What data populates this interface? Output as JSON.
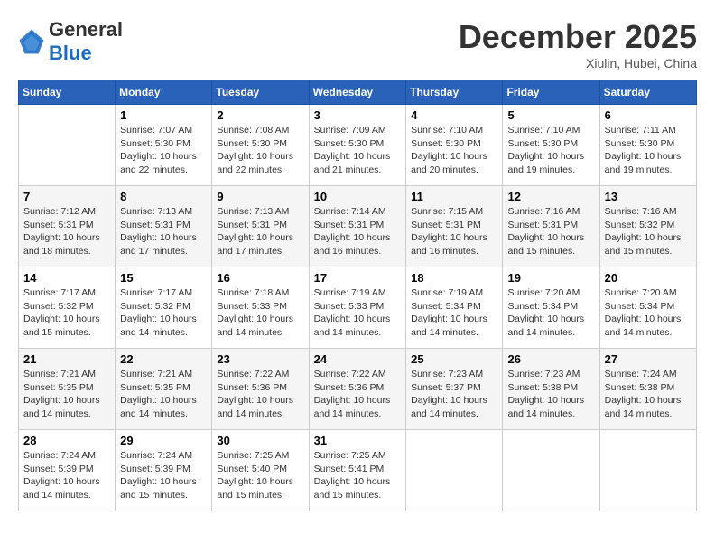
{
  "header": {
    "logo_line1": "General",
    "logo_line2": "Blue",
    "month_title": "December 2025",
    "location": "Xiulin, Hubei, China"
  },
  "calendar": {
    "days_of_week": [
      "Sunday",
      "Monday",
      "Tuesday",
      "Wednesday",
      "Thursday",
      "Friday",
      "Saturday"
    ],
    "weeks": [
      [
        {
          "day": "",
          "info": ""
        },
        {
          "day": "1",
          "info": "Sunrise: 7:07 AM\nSunset: 5:30 PM\nDaylight: 10 hours\nand 22 minutes."
        },
        {
          "day": "2",
          "info": "Sunrise: 7:08 AM\nSunset: 5:30 PM\nDaylight: 10 hours\nand 22 minutes."
        },
        {
          "day": "3",
          "info": "Sunrise: 7:09 AM\nSunset: 5:30 PM\nDaylight: 10 hours\nand 21 minutes."
        },
        {
          "day": "4",
          "info": "Sunrise: 7:10 AM\nSunset: 5:30 PM\nDaylight: 10 hours\nand 20 minutes."
        },
        {
          "day": "5",
          "info": "Sunrise: 7:10 AM\nSunset: 5:30 PM\nDaylight: 10 hours\nand 19 minutes."
        },
        {
          "day": "6",
          "info": "Sunrise: 7:11 AM\nSunset: 5:30 PM\nDaylight: 10 hours\nand 19 minutes."
        }
      ],
      [
        {
          "day": "7",
          "info": "Sunrise: 7:12 AM\nSunset: 5:31 PM\nDaylight: 10 hours\nand 18 minutes."
        },
        {
          "day": "8",
          "info": "Sunrise: 7:13 AM\nSunset: 5:31 PM\nDaylight: 10 hours\nand 17 minutes."
        },
        {
          "day": "9",
          "info": "Sunrise: 7:13 AM\nSunset: 5:31 PM\nDaylight: 10 hours\nand 17 minutes."
        },
        {
          "day": "10",
          "info": "Sunrise: 7:14 AM\nSunset: 5:31 PM\nDaylight: 10 hours\nand 16 minutes."
        },
        {
          "day": "11",
          "info": "Sunrise: 7:15 AM\nSunset: 5:31 PM\nDaylight: 10 hours\nand 16 minutes."
        },
        {
          "day": "12",
          "info": "Sunrise: 7:16 AM\nSunset: 5:31 PM\nDaylight: 10 hours\nand 15 minutes."
        },
        {
          "day": "13",
          "info": "Sunrise: 7:16 AM\nSunset: 5:32 PM\nDaylight: 10 hours\nand 15 minutes."
        }
      ],
      [
        {
          "day": "14",
          "info": "Sunrise: 7:17 AM\nSunset: 5:32 PM\nDaylight: 10 hours\nand 15 minutes."
        },
        {
          "day": "15",
          "info": "Sunrise: 7:17 AM\nSunset: 5:32 PM\nDaylight: 10 hours\nand 14 minutes."
        },
        {
          "day": "16",
          "info": "Sunrise: 7:18 AM\nSunset: 5:33 PM\nDaylight: 10 hours\nand 14 minutes."
        },
        {
          "day": "17",
          "info": "Sunrise: 7:19 AM\nSunset: 5:33 PM\nDaylight: 10 hours\nand 14 minutes."
        },
        {
          "day": "18",
          "info": "Sunrise: 7:19 AM\nSunset: 5:34 PM\nDaylight: 10 hours\nand 14 minutes."
        },
        {
          "day": "19",
          "info": "Sunrise: 7:20 AM\nSunset: 5:34 PM\nDaylight: 10 hours\nand 14 minutes."
        },
        {
          "day": "20",
          "info": "Sunrise: 7:20 AM\nSunset: 5:34 PM\nDaylight: 10 hours\nand 14 minutes."
        }
      ],
      [
        {
          "day": "21",
          "info": "Sunrise: 7:21 AM\nSunset: 5:35 PM\nDaylight: 10 hours\nand 14 minutes."
        },
        {
          "day": "22",
          "info": "Sunrise: 7:21 AM\nSunset: 5:35 PM\nDaylight: 10 hours\nand 14 minutes."
        },
        {
          "day": "23",
          "info": "Sunrise: 7:22 AM\nSunset: 5:36 PM\nDaylight: 10 hours\nand 14 minutes."
        },
        {
          "day": "24",
          "info": "Sunrise: 7:22 AM\nSunset: 5:36 PM\nDaylight: 10 hours\nand 14 minutes."
        },
        {
          "day": "25",
          "info": "Sunrise: 7:23 AM\nSunset: 5:37 PM\nDaylight: 10 hours\nand 14 minutes."
        },
        {
          "day": "26",
          "info": "Sunrise: 7:23 AM\nSunset: 5:38 PM\nDaylight: 10 hours\nand 14 minutes."
        },
        {
          "day": "27",
          "info": "Sunrise: 7:24 AM\nSunset: 5:38 PM\nDaylight: 10 hours\nand 14 minutes."
        }
      ],
      [
        {
          "day": "28",
          "info": "Sunrise: 7:24 AM\nSunset: 5:39 PM\nDaylight: 10 hours\nand 14 minutes."
        },
        {
          "day": "29",
          "info": "Sunrise: 7:24 AM\nSunset: 5:39 PM\nDaylight: 10 hours\nand 15 minutes."
        },
        {
          "day": "30",
          "info": "Sunrise: 7:25 AM\nSunset: 5:40 PM\nDaylight: 10 hours\nand 15 minutes."
        },
        {
          "day": "31",
          "info": "Sunrise: 7:25 AM\nSunset: 5:41 PM\nDaylight: 10 hours\nand 15 minutes."
        },
        {
          "day": "",
          "info": ""
        },
        {
          "day": "",
          "info": ""
        },
        {
          "day": "",
          "info": ""
        }
      ]
    ]
  }
}
